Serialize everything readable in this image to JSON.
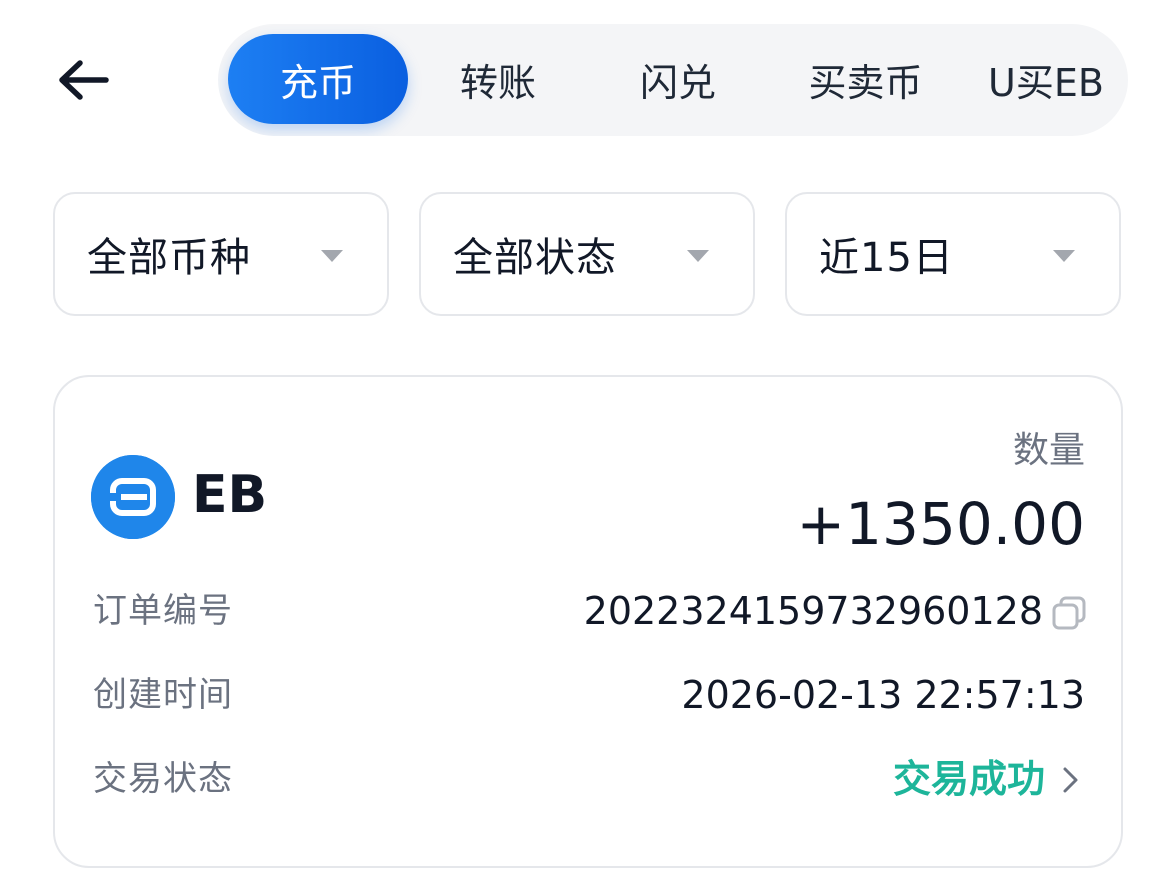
{
  "header": {
    "back_icon": "arrow-left-icon",
    "tabs": [
      {
        "label": "充币",
        "active": true
      },
      {
        "label": "转账",
        "active": false
      },
      {
        "label": "闪兑",
        "active": false
      },
      {
        "label": "买卖币",
        "active": false
      },
      {
        "label": "U买EB",
        "active": false
      }
    ]
  },
  "filters": [
    {
      "label": "全部币种"
    },
    {
      "label": "全部状态"
    },
    {
      "label": "近15日"
    }
  ],
  "record": {
    "coin": {
      "name": "EB",
      "logo_icon": "eb-coin-logo"
    },
    "quantity_label": "数量",
    "quantity_value": "+1350.00",
    "rows": {
      "order_label": "订单编号",
      "order_value": "2022324159732960128",
      "time_label": "创建时间",
      "time_value": "2026-02-13 22:57:13",
      "status_label": "交易状态",
      "status_value": "交易成功"
    }
  },
  "colors": {
    "accent": "#1d7ff3",
    "success": "#1db59a",
    "muted_text": "#6b7280",
    "border": "#e5e7eb"
  }
}
